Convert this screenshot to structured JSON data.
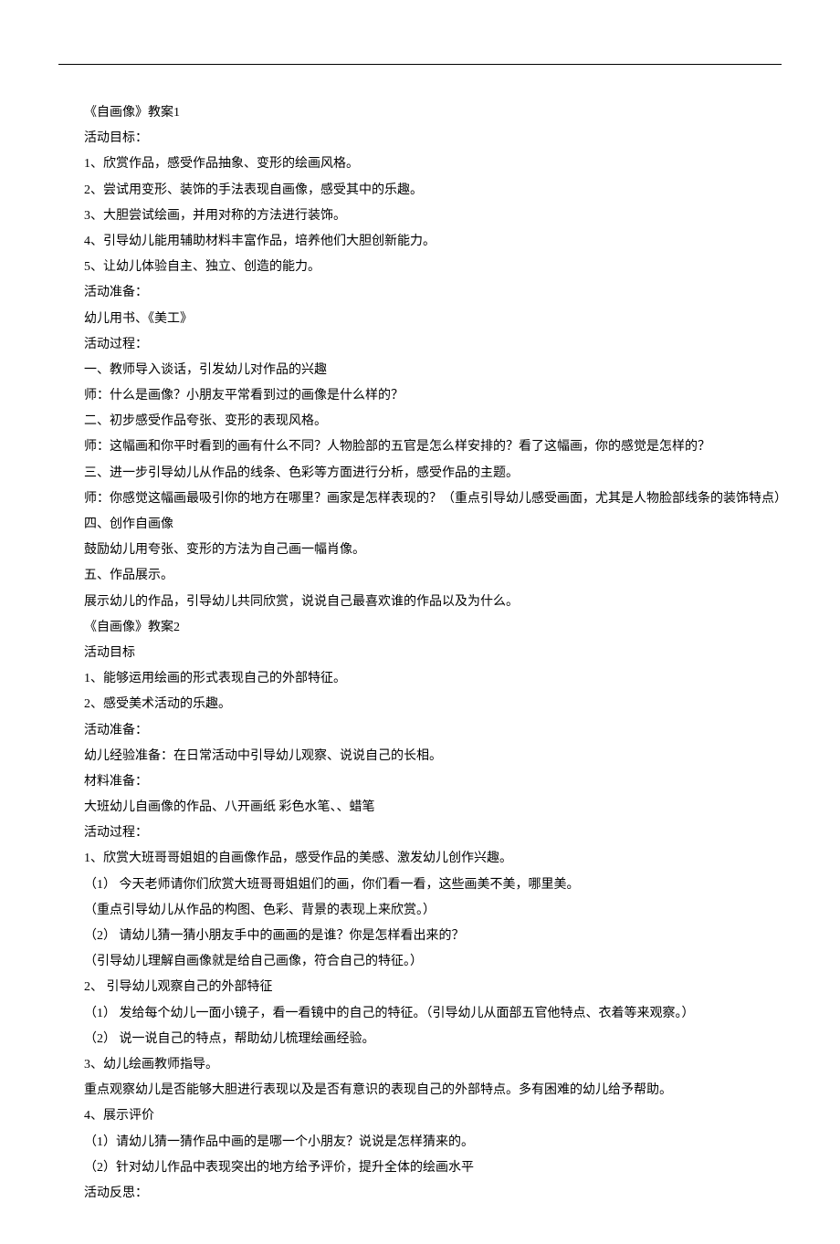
{
  "lines": [
    "《自画像》教案1",
    "活动目标：",
    "1、欣赏作品，感受作品抽象、变形的绘画风格。",
    "2、尝试用变形、装饰的手法表现自画像，感受其中的乐趣。",
    "3、大胆尝试绘画，并用对称的方法进行装饰。",
    "4、引导幼儿能用辅助材料丰富作品，培养他们大胆创新能力。",
    "5、让幼儿体验自主、独立、创造的能力。",
    "活动准备：",
    "幼儿用书、《美工》",
    "活动过程：",
    "一、教师导入谈话，引发幼儿对作品的兴趣",
    "师：什么是画像？小朋友平常看到过的画像是什么样的？",
    "二、初步感受作品夸张、变形的表现风格。",
    "师：这幅画和你平时看到的画有什么不同？人物脸部的五官是怎么样安排的？看了这幅画，你的感觉是怎样的？",
    "三、进一步引导幼儿从作品的线条、色彩等方面进行分析，感受作品的主题。",
    {
      "text": "师：你感觉这幅画最吸引你的地方在哪里？画家是怎样表现的？（重点引导幼儿感受画面，尤其是人物脸部线条的装饰特点）",
      "wrap": true
    },
    "四、创作自画像",
    "鼓励幼儿用夸张、变形的方法为自己画一幅肖像。",
    "五、作品展示。",
    "展示幼儿的作品，引导幼儿共同欣赏，说说自己最喜欢谁的作品以及为什么。",
    "《自画像》教案2",
    "活动目标",
    "1、能够运用绘画的形式表现自己的外部特征。",
    "2、感受美术活动的乐趣。",
    "活动准备：",
    "幼儿经验准备：在日常活动中引导幼儿观察、说说自己的长相。",
    "材料准备：",
    "大班幼儿自画像的作品、八开画纸 彩色水笔、、蜡笔",
    "活动过程：",
    "1、欣赏大班哥哥姐姐的自画像作品，感受作品的美感、激发幼儿创作兴趣。",
    "（1） 今天老师请你们欣赏大班哥哥姐姐们的画，你们看一看，这些画美不美，哪里美。",
    "（重点引导幼儿从作品的构图、色彩、背景的表现上来欣赏。）",
    "（2） 请幼儿猜一猜小朋友手中的画画的是谁？你是怎样看出来的？",
    "（引导幼儿理解自画像就是给自己画像，符合自己的特征。）",
    "2、 引导幼儿观察自己的外部特征",
    "（1） 发给每个幼儿一面小镜子，看一看镜中的自己的特征。（引导幼儿从面部五官他特点、衣着等来观察。）",
    "（2） 说一说自己的特点，帮助幼儿梳理绘画经验。",
    "3、幼儿绘画教师指导。",
    "重点观察幼儿是否能够大胆进行表现以及是否有意识的表现自己的外部特点。多有困难的幼儿给予帮助。",
    "4、展示评价",
    "（1）请幼儿猜一猜作品中画的是哪一个小朋友？说说是怎样猜来的。",
    "（2）针对幼儿作品中表现突出的地方给予评价，提升全体的绘画水平",
    "活动反思："
  ]
}
